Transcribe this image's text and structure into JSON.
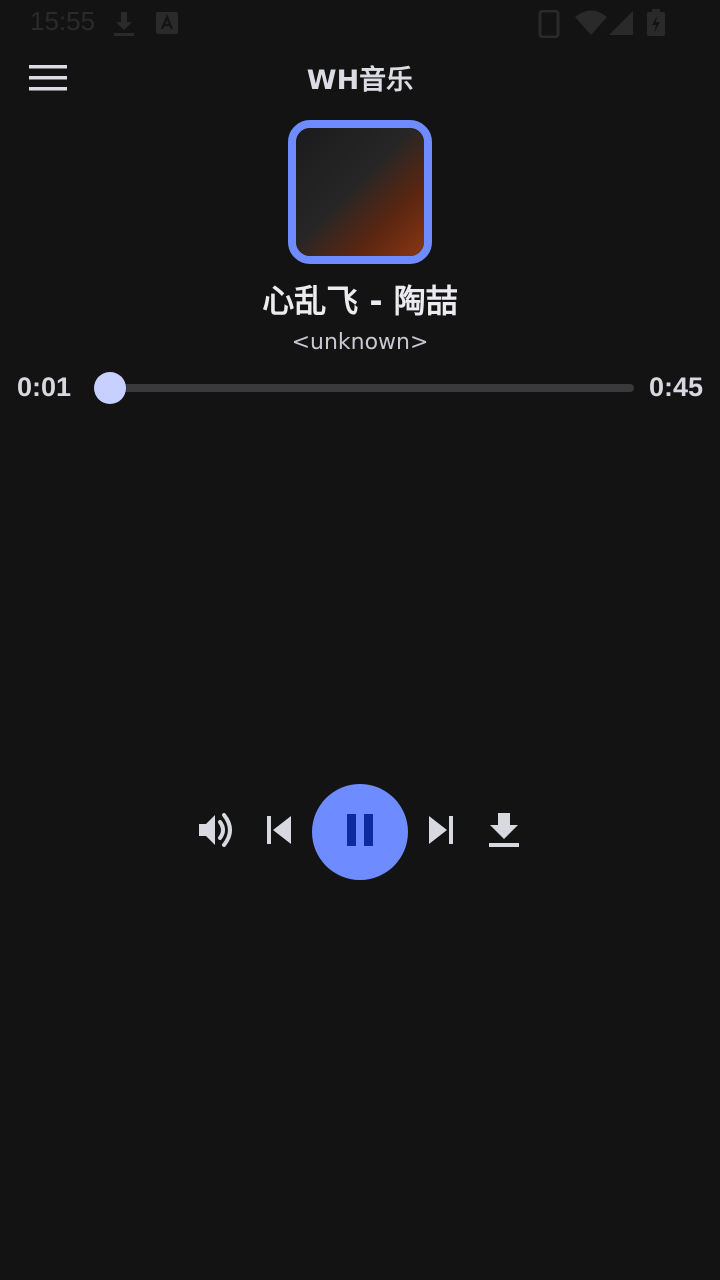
{
  "status_bar": {
    "time": "15:55"
  },
  "app_bar": {
    "title": "WH音乐"
  },
  "now_playing": {
    "title": "心乱飞 - 陶喆",
    "artist": "<unknown>"
  },
  "progress": {
    "current": "0:01",
    "total": "0:45",
    "fraction": 0.022
  },
  "controls": {
    "volume_icon": "volume-up-icon",
    "previous_icon": "skip-previous-icon",
    "play_pause_icon": "pause-icon",
    "next_icon": "skip-next-icon",
    "download_icon": "download-icon"
  },
  "colors": {
    "background": "#131313",
    "accent": "#6e8cff",
    "seek_thumb": "#c7d0ff",
    "track": "#3a3a3c",
    "pause_glyph": "#0d2a9e"
  }
}
